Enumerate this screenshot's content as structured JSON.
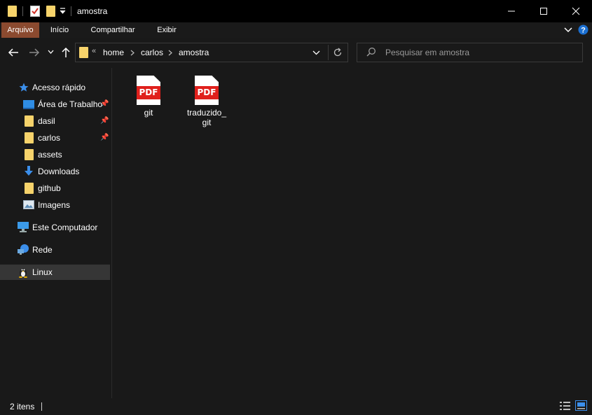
{
  "window": {
    "title": "amostra",
    "quick_access_toolbar": [
      "folder-icon",
      "properties-icon",
      "new-folder-icon",
      "customize-dropdown"
    ],
    "controls": [
      "minimize",
      "maximize",
      "close"
    ]
  },
  "ribbon": {
    "tabs": [
      {
        "label": "Arquivo",
        "active": true
      },
      {
        "label": "Início"
      },
      {
        "label": "Compartilhar"
      },
      {
        "label": "Exibir"
      }
    ]
  },
  "address_bar": {
    "overflow": "«",
    "breadcrumbs": [
      "home",
      "carlos",
      "amostra"
    ]
  },
  "search": {
    "placeholder": "Pesquisar em amostra"
  },
  "nav_pane": {
    "quick_access": {
      "label": "Acesso rápido"
    },
    "items": [
      {
        "label": "Área de Trabalho",
        "icon": "desktop-icon",
        "pinned": true
      },
      {
        "label": "dasil",
        "icon": "folder-icon",
        "pinned": true
      },
      {
        "label": "carlos",
        "icon": "folder-icon",
        "pinned": true
      },
      {
        "label": "assets",
        "icon": "folder-icon",
        "pinned": false
      },
      {
        "label": "Downloads",
        "icon": "download-icon",
        "pinned": false
      },
      {
        "label": "github",
        "icon": "folder-icon",
        "pinned": false
      },
      {
        "label": "Imagens",
        "icon": "pictures-icon",
        "pinned": false
      }
    ],
    "this_pc": {
      "label": "Este Computador"
    },
    "network": {
      "label": "Rede"
    },
    "linux": {
      "label": "Linux",
      "selected": true
    }
  },
  "files": [
    {
      "name": "git",
      "type": "PDF"
    },
    {
      "name": "traduzido_git",
      "line1": "traduzido_",
      "line2": "git",
      "type": "PDF"
    }
  ],
  "status": {
    "item_count": "2 itens"
  },
  "colors": {
    "accent_tab": "#8b4a2f",
    "pdf_red": "#e0201c",
    "folder_yellow": "#f7d36b",
    "selected_nav": "#363636"
  }
}
